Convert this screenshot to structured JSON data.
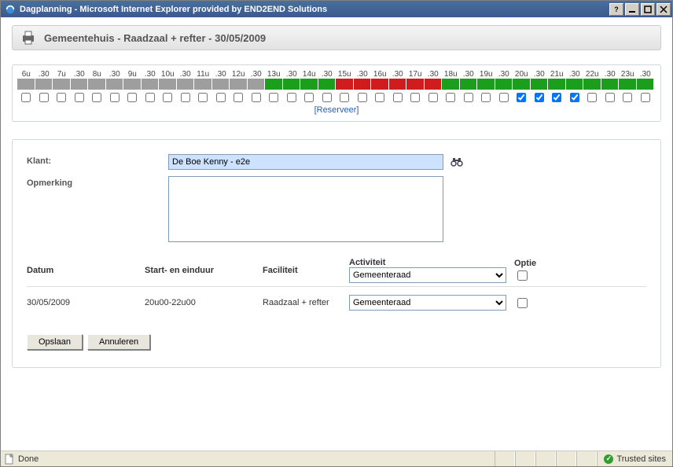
{
  "window": {
    "title": "Dagplanning - Microsoft Internet Explorer provided by END2END Solutions"
  },
  "header": {
    "text": "Gemeentehuis - Raadzaal + refter - 30/05/2009"
  },
  "timeline": {
    "labels": [
      "6u",
      ".30",
      "7u",
      ".30",
      "8u",
      ".30",
      "9u",
      ".30",
      "10u",
      ".30",
      "11u",
      ".30",
      "12u",
      ".30",
      "13u",
      ".30",
      "14u",
      ".30",
      "15u",
      ".30",
      "16u",
      ".30",
      "17u",
      ".30",
      "18u",
      ".30",
      "19u",
      ".30",
      "20u",
      ".30",
      "21u",
      ".30",
      "22u",
      ".30",
      "23u",
      ".30"
    ],
    "slot_states": [
      "gray",
      "gray",
      "gray",
      "gray",
      "gray",
      "gray",
      "gray",
      "gray",
      "gray",
      "gray",
      "gray",
      "gray",
      "gray",
      "gray",
      "green",
      "green",
      "green",
      "green",
      "red",
      "red",
      "red",
      "red",
      "red",
      "red",
      "green",
      "green",
      "green",
      "green",
      "green",
      "green",
      "green",
      "green",
      "green",
      "green",
      "green",
      "green"
    ],
    "checked": [
      false,
      false,
      false,
      false,
      false,
      false,
      false,
      false,
      false,
      false,
      false,
      false,
      false,
      false,
      false,
      false,
      false,
      false,
      false,
      false,
      false,
      false,
      false,
      false,
      false,
      false,
      false,
      false,
      true,
      true,
      true,
      true,
      false,
      false,
      false,
      false
    ],
    "reserve_label": "[Reserveer]"
  },
  "form": {
    "klant_label": "Klant:",
    "klant_value": "De Boe Kenny - e2e",
    "opmerking_label": "Opmerking",
    "opmerking_value": ""
  },
  "table": {
    "headers": {
      "datum": "Datum",
      "start_eind": "Start- en einduur",
      "faciliteit": "Faciliteit",
      "activiteit": "Activiteit",
      "optie": "Optie"
    },
    "header_activity": "Gemeenteraad",
    "rows": [
      {
        "datum": "30/05/2009",
        "tijd": "20u00-22u00",
        "faciliteit": "Raadzaal + refter",
        "activiteit": "Gemeenteraad",
        "optie": false
      }
    ]
  },
  "buttons": {
    "save": "Opslaan",
    "cancel": "Annuleren"
  },
  "status": {
    "left": "Done",
    "right": "Trusted sites"
  }
}
